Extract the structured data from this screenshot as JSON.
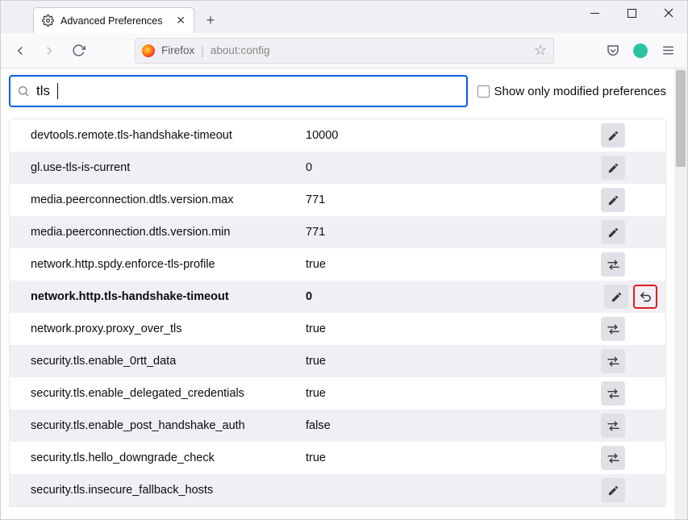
{
  "tab": {
    "title": "Advanced Preferences"
  },
  "urlbar": {
    "identity": "Firefox",
    "url": "about:config"
  },
  "search": {
    "value": "tls"
  },
  "show_modified_label": "Show only modified preferences",
  "prefs": [
    {
      "name": "devtools.remote.tls-handshake-timeout",
      "value": "10000",
      "action": "edit",
      "modified": false
    },
    {
      "name": "gl.use-tls-is-current",
      "value": "0",
      "action": "edit",
      "modified": false
    },
    {
      "name": "media.peerconnection.dtls.version.max",
      "value": "771",
      "action": "edit",
      "modified": false
    },
    {
      "name": "media.peerconnection.dtls.version.min",
      "value": "771",
      "action": "edit",
      "modified": false
    },
    {
      "name": "network.http.spdy.enforce-tls-profile",
      "value": "true",
      "action": "toggle",
      "modified": false
    },
    {
      "name": "network.http.tls-handshake-timeout",
      "value": "0",
      "action": "edit",
      "modified": true,
      "reset": true
    },
    {
      "name": "network.proxy.proxy_over_tls",
      "value": "true",
      "action": "toggle",
      "modified": false
    },
    {
      "name": "security.tls.enable_0rtt_data",
      "value": "true",
      "action": "toggle",
      "modified": false
    },
    {
      "name": "security.tls.enable_delegated_credentials",
      "value": "true",
      "action": "toggle",
      "modified": false
    },
    {
      "name": "security.tls.enable_post_handshake_auth",
      "value": "false",
      "action": "toggle",
      "modified": false
    },
    {
      "name": "security.tls.hello_downgrade_check",
      "value": "true",
      "action": "toggle",
      "modified": false
    },
    {
      "name": "security.tls.insecure_fallback_hosts",
      "value": "",
      "action": "edit",
      "modified": false
    }
  ]
}
